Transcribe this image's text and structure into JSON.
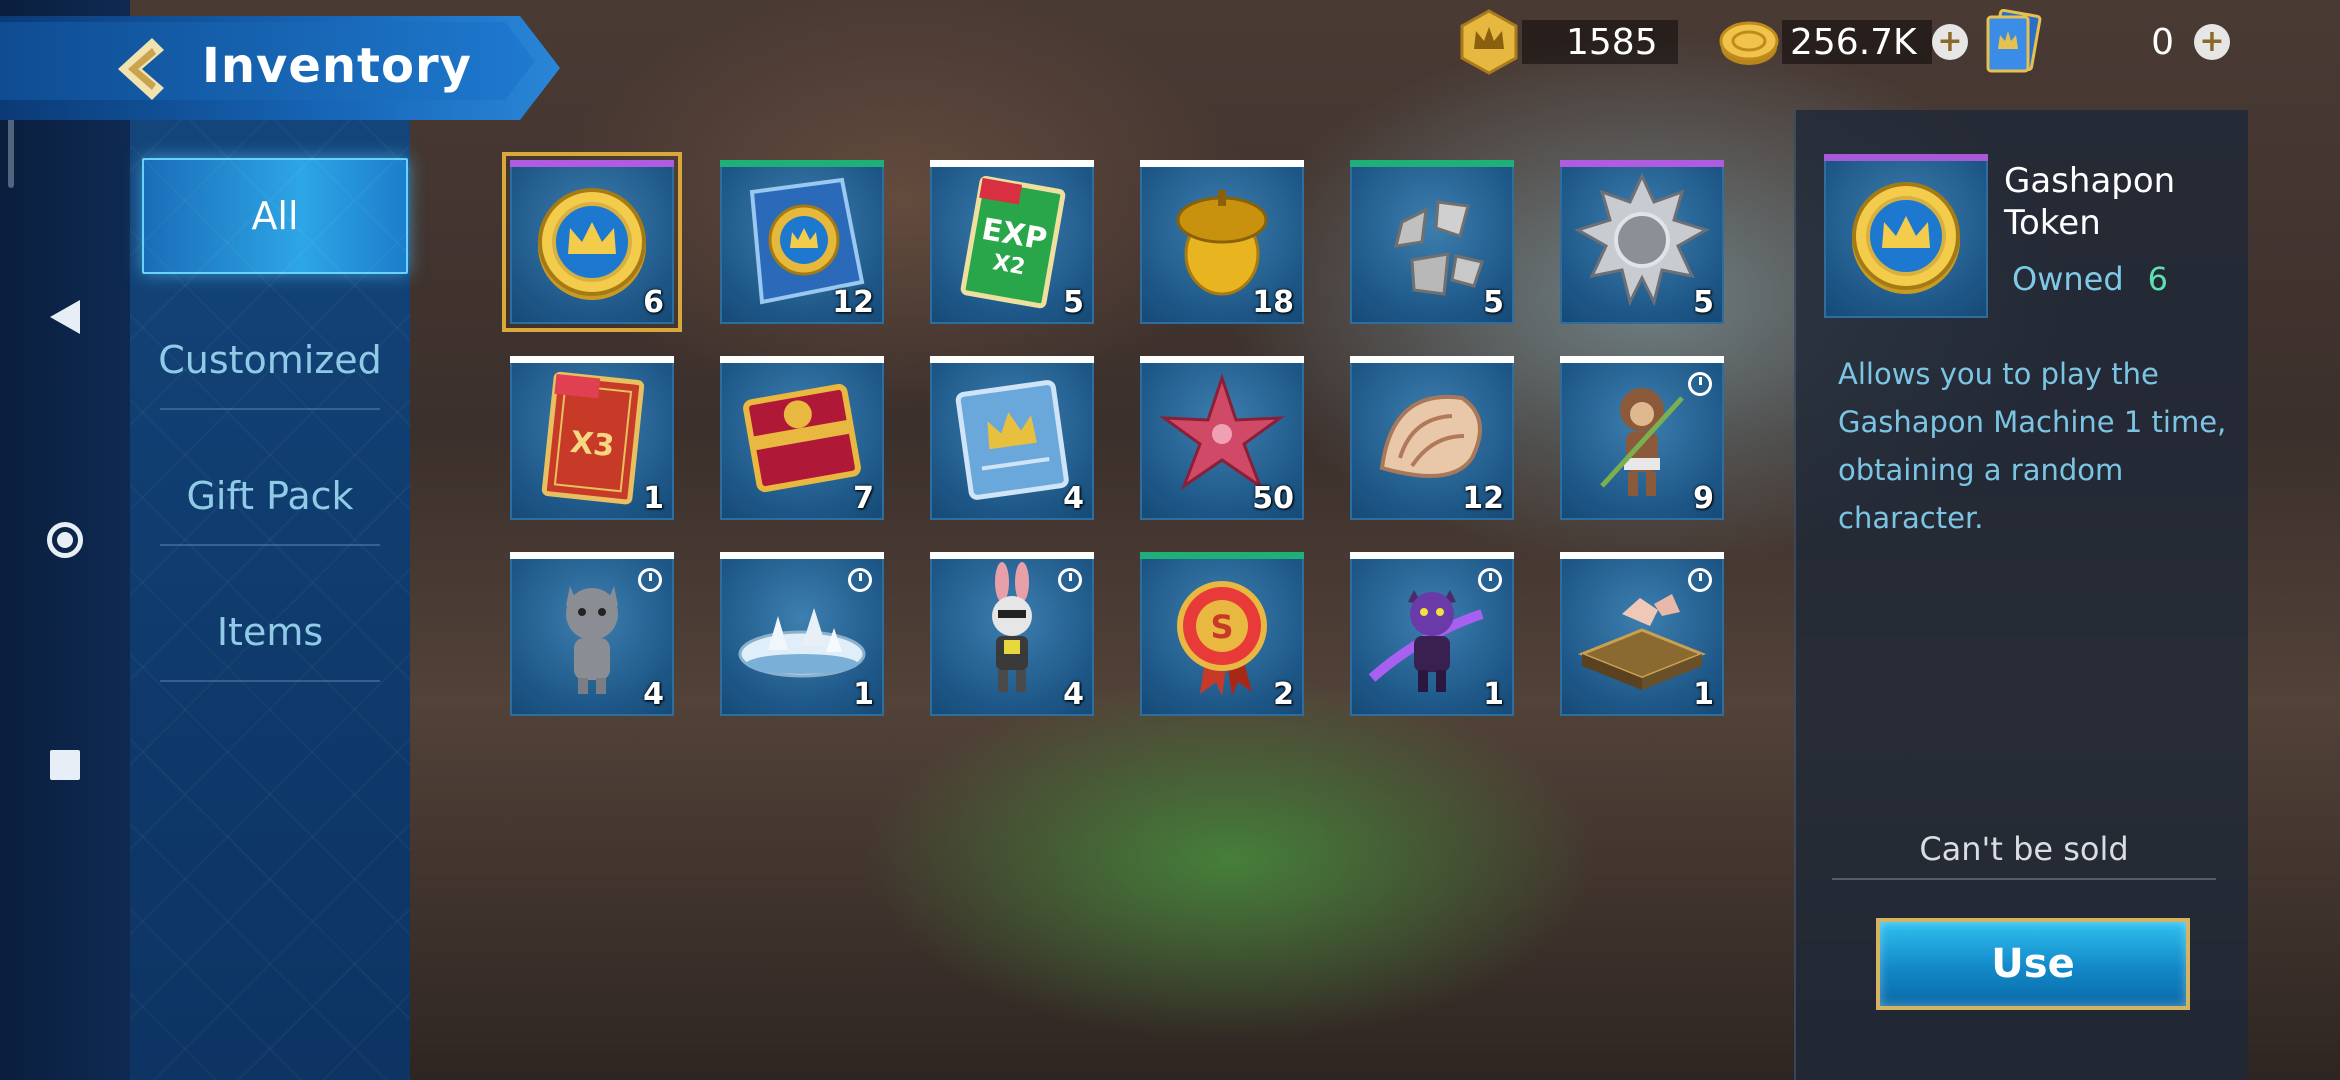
{
  "header": {
    "title": "Inventory"
  },
  "currencies": [
    {
      "icon": "crown-medal-icon",
      "value": "1585"
    },
    {
      "icon": "gold-coin-icon",
      "value": "256.7K"
    },
    {
      "icon": "ticket-cards-icon",
      "value": "0"
    }
  ],
  "categories": [
    "All",
    "Customized",
    "Gift Pack",
    "Items"
  ],
  "items": [
    {
      "icon": "gashapon-token-icon",
      "qty": "6",
      "rarity": "#b05ce0"
    },
    {
      "icon": "crown-crystal-icon",
      "qty": "12",
      "rarity": "#1fb07a"
    },
    {
      "icon": "exp-x2-card-icon",
      "qty": "5",
      "rarity": "#ffffff"
    },
    {
      "icon": "golden-acorn-icon",
      "qty": "18",
      "rarity": "#ffffff"
    },
    {
      "icon": "gear-fragments-icon",
      "qty": "5",
      "rarity": "#1fb07a"
    },
    {
      "icon": "silver-gear-icon",
      "qty": "5",
      "rarity": "#b05ce0"
    },
    {
      "icon": "x3-card-icon",
      "qty": "1",
      "rarity": "#ffffff"
    },
    {
      "icon": "red-gift-box-icon",
      "qty": "7",
      "rarity": "#ffffff"
    },
    {
      "icon": "blue-crown-card-icon",
      "qty": "4",
      "rarity": "#ffffff"
    },
    {
      "icon": "starfish-icon",
      "qty": "50",
      "rarity": "#ffffff"
    },
    {
      "icon": "seashell-icon",
      "qty": "12",
      "rarity": "#ffffff"
    },
    {
      "icon": "monkey-character-icon",
      "qty": "9",
      "rarity": "#ffffff",
      "timed": true
    },
    {
      "icon": "cat-character-icon",
      "qty": "4",
      "rarity": "#ffffff",
      "timed": true
    },
    {
      "icon": "snow-island-icon",
      "qty": "1",
      "rarity": "#ffffff",
      "timed": true
    },
    {
      "icon": "rabbit-character-icon",
      "qty": "4",
      "rarity": "#ffffff",
      "timed": true
    },
    {
      "icon": "rosette-badge-icon",
      "qty": "2",
      "rarity": "#1fb07a"
    },
    {
      "icon": "demon-character-icon",
      "qty": "1",
      "rarity": "#ffffff",
      "timed": true
    },
    {
      "icon": "treasure-platform-icon",
      "qty": "1",
      "rarity": "#ffffff",
      "timed": true
    }
  ],
  "detail": {
    "name": "Gashapon Token",
    "owned_label": "Owned",
    "owned_count": "6",
    "description": "Allows you to play the Gashapon Machine 1 time, obtaining a random character.",
    "sell_status": "Can't be sold",
    "use_label": "Use"
  },
  "colors": {
    "accent": "#2da6e6",
    "gold_border": "#d4b463"
  }
}
